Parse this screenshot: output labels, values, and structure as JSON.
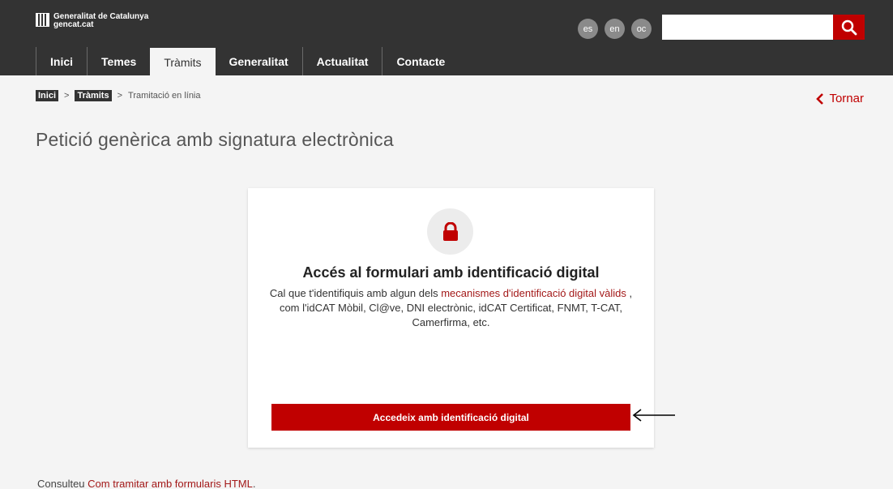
{
  "header": {
    "logo": {
      "line1": "Generalitat de Catalunya",
      "line2": "gencat.cat"
    },
    "languages": [
      "es",
      "en",
      "oc"
    ],
    "search": {
      "placeholder": ""
    }
  },
  "nav": {
    "items": [
      {
        "label": "Inici"
      },
      {
        "label": "Temes"
      },
      {
        "label": "Tràmits",
        "active": true
      },
      {
        "label": "Generalitat"
      },
      {
        "label": "Actualitat"
      },
      {
        "label": "Contacte"
      }
    ]
  },
  "breadcrumb": {
    "home": "Inici",
    "section": "Tràmits",
    "sep": ">",
    "current": "Tramitació en línia"
  },
  "back": {
    "label": "Tornar"
  },
  "page": {
    "title": "Petició genèrica amb signatura electrònica"
  },
  "card": {
    "title": "Accés al formulari amb identificació digital",
    "desc_before": "Cal que t'identifiquis amb algun dels ",
    "desc_link": "mecanismes d'identificació digital vàlids",
    "desc_after": " , com l'idCAT Mòbil, Cl@ve, DNI electrònic, idCAT Certificat, FNMT, T-CAT, Camerfirma, etc.",
    "button": "Accedeix amb identificació digital"
  },
  "footer": {
    "before": "Consulteu ",
    "link": "Com tramitar amb formularis HTML",
    "after": "."
  },
  "colors": {
    "accent": "#c00000",
    "header_bg": "#333333",
    "page_bg": "#f4f4f4"
  },
  "icons": {
    "search": "search-icon",
    "back": "chevron-left-icon",
    "lock": "lock-icon",
    "arrow": "arrow-left-icon"
  }
}
